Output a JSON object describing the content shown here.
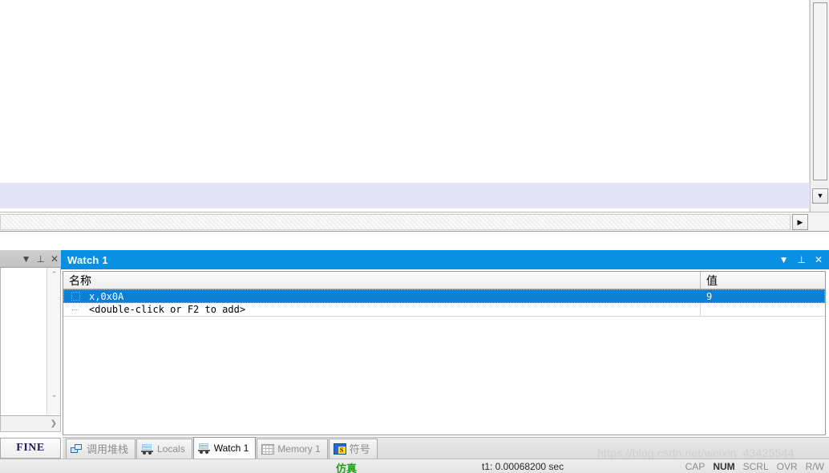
{
  "editor": {
    "vscroll_down_glyph": "▼",
    "hscroll_right_glyph": "▶"
  },
  "left_panel": {
    "titlebar_buttons": [
      {
        "name": "dropdown",
        "glyph": "▼"
      },
      {
        "name": "pin",
        "glyph": "⊥"
      },
      {
        "name": "close",
        "glyph": "✕"
      }
    ],
    "vscroll_up_glyph": "⌃",
    "vscroll_down_glyph": "⌄",
    "hscroll_right_glyph": "❯",
    "tab_label": "FINE"
  },
  "watch_panel": {
    "title": "Watch 1",
    "titlebar_buttons": [
      {
        "name": "dropdown",
        "glyph": "▼"
      },
      {
        "name": "pin",
        "glyph": "⊥"
      },
      {
        "name": "close",
        "glyph": "✕"
      }
    ],
    "columns": [
      {
        "key": "name",
        "header": "名称"
      },
      {
        "key": "value",
        "header": "值"
      }
    ],
    "rows": [
      {
        "name": "x,0x0A",
        "value": "9",
        "selected": true
      },
      {
        "name": "<double-click or F2 to add>",
        "value": "",
        "selected": false
      }
    ]
  },
  "bottom_tabs": [
    {
      "label": "调用堆栈",
      "icon": "call-stack-icon",
      "icon_kind": "stack",
      "active": false,
      "cjk": true
    },
    {
      "label": "Locals",
      "icon": "locals-icon",
      "icon_kind": "van",
      "active": false,
      "cjk": false
    },
    {
      "label": "Watch 1",
      "icon": "watch-icon",
      "icon_kind": "van",
      "active": true,
      "cjk": false
    },
    {
      "label": "Memory 1",
      "icon": "memory-icon",
      "icon_kind": "grid",
      "active": false,
      "cjk": false
    },
    {
      "label": "符号",
      "icon": "symbols-icon",
      "icon_kind": "sym",
      "active": false,
      "cjk": true
    }
  ],
  "statusbar": {
    "simulation_label": "仿真",
    "time_label": "t1: 0.00068200 sec",
    "indicators": [
      {
        "label": "CAP",
        "active": false
      },
      {
        "label": "NUM",
        "active": true
      },
      {
        "label": "SCRL",
        "active": false
      },
      {
        "label": "OVR",
        "active": false
      },
      {
        "label": "R/W",
        "active": false
      }
    ]
  },
  "watermark": {
    "text": "https://blog.csdn.net/weixin_43425544"
  },
  "colors": {
    "title_blue": "#0a90e2",
    "selection_blue": "#0b7fd4",
    "highlight_line": "#e4e4f6",
    "sim_green": "#18a318"
  }
}
